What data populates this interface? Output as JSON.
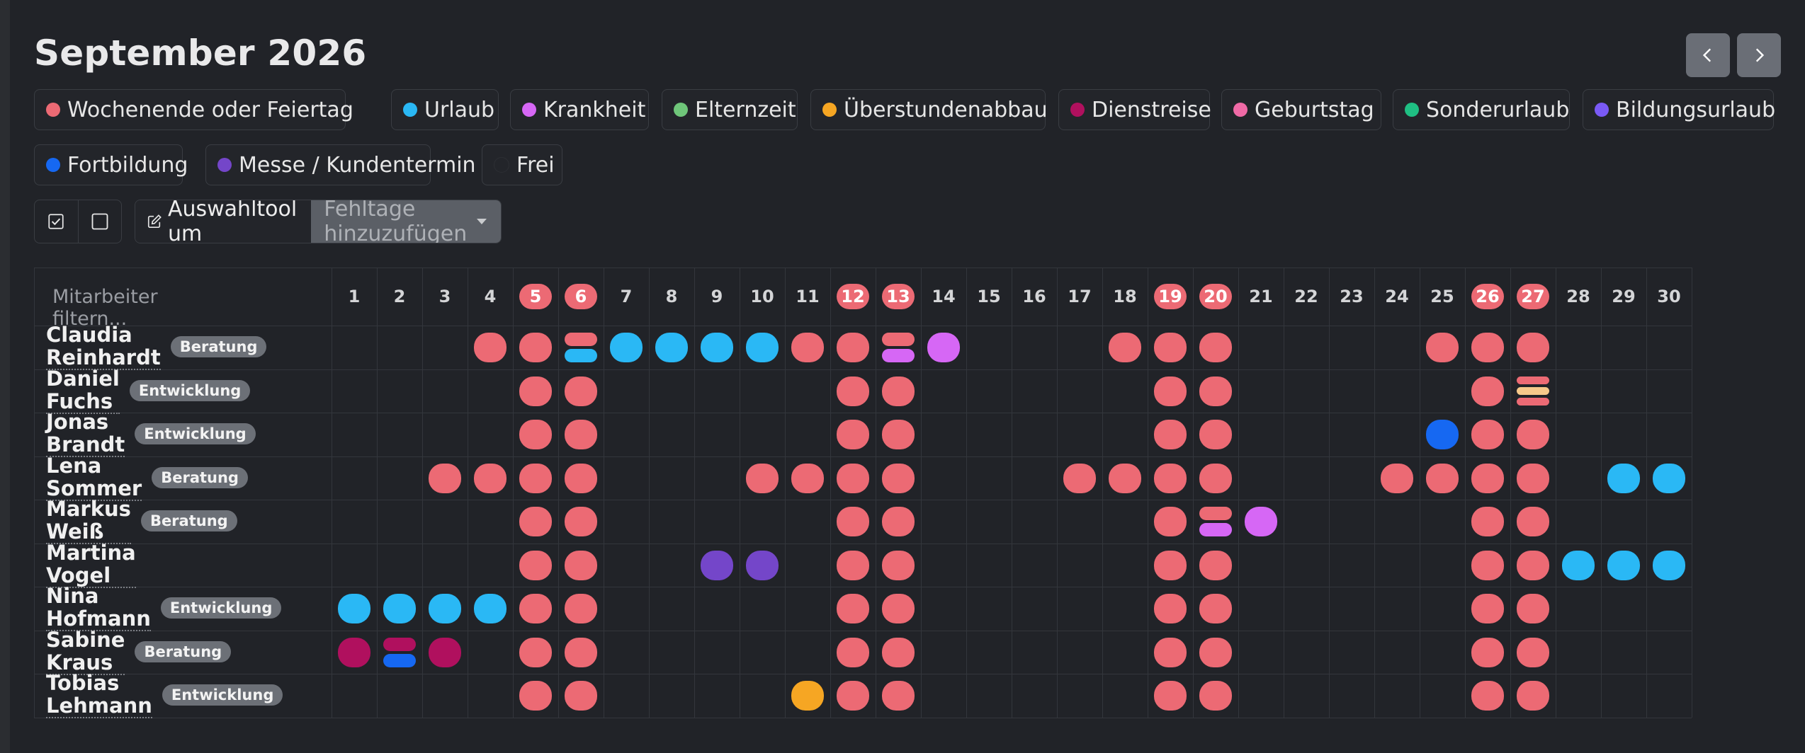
{
  "calendar": {
    "title": "September 2026",
    "prev_label": "previous-month",
    "next_label": "next-month"
  },
  "legend": [
    {
      "key": "weekend",
      "label": "Wochenende oder Feiertag",
      "color": "#ec6a74"
    },
    {
      "key": "urlaub",
      "label": "Urlaub",
      "color": "#2ab8f5"
    },
    {
      "key": "krankheit",
      "label": "Krankheit",
      "color": "#d667f5"
    },
    {
      "key": "elternzeit",
      "label": "Elternzeit",
      "color": "#6fc67a"
    },
    {
      "key": "ueberstunden",
      "label": "Überstundenabbau",
      "color": "#f6a623"
    },
    {
      "key": "dienstreise",
      "label": "Dienstreise",
      "color": "#b0105e"
    },
    {
      "key": "geburtstag",
      "label": "Geburtstag",
      "color": "#f06aa6"
    },
    {
      "key": "sonderurlaub",
      "label": "Sonderurlaub",
      "color": "#1fbf83"
    },
    {
      "key": "bildungsurlaub",
      "label": "Bildungsurlaub",
      "color": "#7a5af5"
    },
    {
      "key": "fortbildung",
      "label": "Fortbildung",
      "color": "#1668f2"
    },
    {
      "key": "messe",
      "label": "Messe / Kundentermin",
      "color": "#7446c9"
    },
    {
      "key": "frei",
      "label": "Frei",
      "color": "#23252a"
    }
  ],
  "toolbar": {
    "tool_label": "Auswahltool um",
    "select_value": "Fehltage hinzuzufügen"
  },
  "table": {
    "filter_placeholder": "Mitarbeiter filtern...",
    "days": [
      1,
      2,
      3,
      4,
      5,
      6,
      7,
      8,
      9,
      10,
      11,
      12,
      13,
      14,
      15,
      16,
      17,
      18,
      19,
      20,
      21,
      22,
      23,
      24,
      25,
      26,
      27,
      28,
      29,
      30
    ],
    "weekend_days": [
      5,
      6,
      12,
      13,
      19,
      20,
      26,
      27
    ],
    "employees": [
      {
        "name": "Claudia Reinhardt",
        "department": "Beratung",
        "absences": {
          "4": [
            "weekend"
          ],
          "5": [
            "weekend"
          ],
          "6": [
            "weekend",
            "urlaub"
          ],
          "7": [
            "urlaub"
          ],
          "8": [
            "urlaub"
          ],
          "9": [
            "urlaub"
          ],
          "10": [
            "urlaub"
          ],
          "11": [
            "weekend"
          ],
          "12": [
            "weekend"
          ],
          "13": [
            "weekend",
            "krankheit"
          ],
          "14": [
            "krankheit"
          ],
          "18": [
            "weekend"
          ],
          "19": [
            "weekend"
          ],
          "20": [
            "weekend"
          ],
          "25": [
            "weekend"
          ],
          "26": [
            "weekend"
          ],
          "27": [
            "weekend"
          ]
        }
      },
      {
        "name": "Daniel Fuchs",
        "department": "Entwicklung",
        "absences": {
          "5": [
            "weekend"
          ],
          "6": [
            "weekend"
          ],
          "12": [
            "weekend"
          ],
          "13": [
            "weekend"
          ],
          "19": [
            "weekend"
          ],
          "20": [
            "weekend"
          ],
          "26": [
            "weekend"
          ],
          "27": [
            "weekend",
            "ueberstunden",
            "weekend"
          ]
        }
      },
      {
        "name": "Jonas Brandt",
        "department": "Entwicklung",
        "absences": {
          "5": [
            "weekend"
          ],
          "6": [
            "weekend"
          ],
          "12": [
            "weekend"
          ],
          "13": [
            "weekend"
          ],
          "19": [
            "weekend"
          ],
          "20": [
            "weekend"
          ],
          "25": [
            "fortbildung"
          ],
          "26": [
            "weekend"
          ],
          "27": [
            "weekend"
          ]
        }
      },
      {
        "name": "Lena Sommer",
        "department": "Beratung",
        "absences": {
          "3": [
            "weekend"
          ],
          "4": [
            "weekend"
          ],
          "5": [
            "weekend"
          ],
          "6": [
            "weekend"
          ],
          "10": [
            "weekend"
          ],
          "11": [
            "weekend"
          ],
          "12": [
            "weekend"
          ],
          "13": [
            "weekend"
          ],
          "17": [
            "weekend"
          ],
          "18": [
            "weekend"
          ],
          "19": [
            "weekend"
          ],
          "20": [
            "weekend"
          ],
          "24": [
            "weekend"
          ],
          "25": [
            "weekend"
          ],
          "26": [
            "weekend"
          ],
          "27": [
            "weekend"
          ],
          "29": [
            "urlaub"
          ],
          "30": [
            "urlaub"
          ]
        }
      },
      {
        "name": "Markus Weiß",
        "department": "Beratung",
        "absences": {
          "5": [
            "weekend"
          ],
          "6": [
            "weekend"
          ],
          "12": [
            "weekend"
          ],
          "13": [
            "weekend"
          ],
          "19": [
            "weekend"
          ],
          "20": [
            "weekend",
            "krankheit"
          ],
          "21": [
            "krankheit"
          ],
          "26": [
            "weekend"
          ],
          "27": [
            "weekend"
          ]
        }
      },
      {
        "name": "Martina Vogel",
        "department": "",
        "absences": {
          "5": [
            "weekend"
          ],
          "6": [
            "weekend"
          ],
          "9": [
            "messe"
          ],
          "10": [
            "messe"
          ],
          "12": [
            "weekend"
          ],
          "13": [
            "weekend"
          ],
          "19": [
            "weekend"
          ],
          "20": [
            "weekend"
          ],
          "26": [
            "weekend"
          ],
          "27": [
            "weekend"
          ],
          "28": [
            "urlaub"
          ],
          "29": [
            "urlaub"
          ],
          "30": [
            "urlaub"
          ]
        }
      },
      {
        "name": "Nina Hofmann",
        "department": "Entwicklung",
        "absences": {
          "1": [
            "urlaub"
          ],
          "2": [
            "urlaub"
          ],
          "3": [
            "urlaub"
          ],
          "4": [
            "urlaub"
          ],
          "5": [
            "weekend"
          ],
          "6": [
            "weekend"
          ],
          "12": [
            "weekend"
          ],
          "13": [
            "weekend"
          ],
          "19": [
            "weekend"
          ],
          "20": [
            "weekend"
          ],
          "26": [
            "weekend"
          ],
          "27": [
            "weekend"
          ]
        }
      },
      {
        "name": "Sabine Kraus",
        "department": "Beratung",
        "absences": {
          "1": [
            "dienstreise"
          ],
          "2": [
            "dienstreise",
            "fortbildung"
          ],
          "3": [
            "dienstreise"
          ],
          "5": [
            "weekend"
          ],
          "6": [
            "weekend"
          ],
          "12": [
            "weekend"
          ],
          "13": [
            "weekend"
          ],
          "19": [
            "weekend"
          ],
          "20": [
            "weekend"
          ],
          "26": [
            "weekend"
          ],
          "27": [
            "weekend"
          ]
        }
      },
      {
        "name": "Tobias Lehmann",
        "department": "Entwicklung",
        "absences": {
          "5": [
            "weekend"
          ],
          "6": [
            "weekend"
          ],
          "11": [
            "ueberstunden"
          ],
          "12": [
            "weekend"
          ],
          "13": [
            "weekend"
          ],
          "19": [
            "weekend"
          ],
          "20": [
            "weekend"
          ],
          "26": [
            "weekend"
          ],
          "27": [
            "weekend"
          ]
        }
      }
    ]
  },
  "colors": {
    "ueberstunden_light": "#f6c98a"
  }
}
